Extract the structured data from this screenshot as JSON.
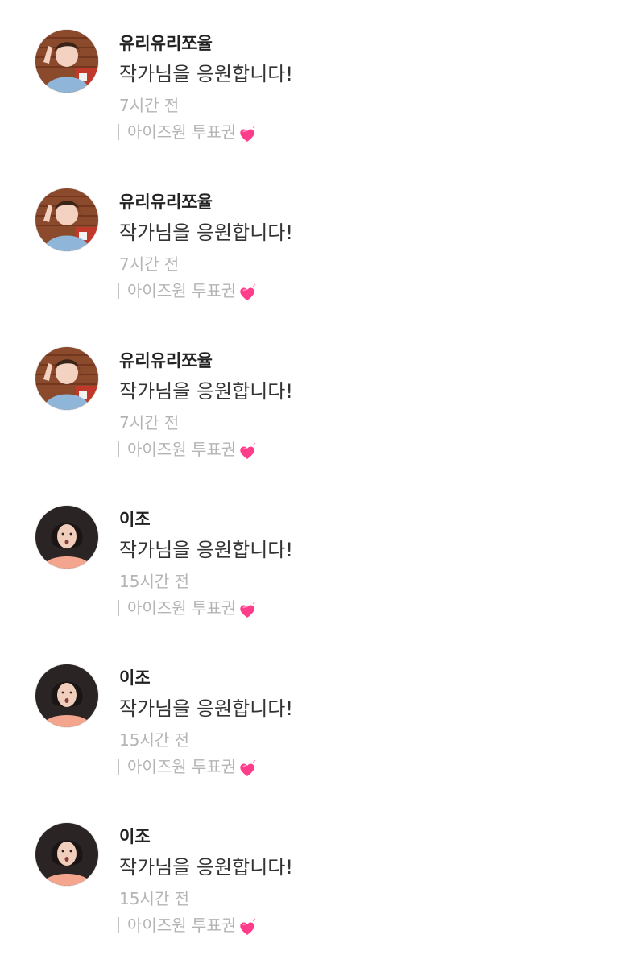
{
  "comments": [
    {
      "username": "유리유리쪼율",
      "text": "작가님을 응원합니다!",
      "time": "7시간 전",
      "vote": "아이즈원 투표권",
      "avatar_icon": "profile-photo-girl-brick-background",
      "heart_icon": "growing-heart-emoji"
    },
    {
      "username": "유리유리쪼율",
      "text": "작가님을 응원합니다!",
      "time": "7시간 전",
      "vote": "아이즈원 투표권",
      "avatar_icon": "profile-photo-girl-brick-background",
      "heart_icon": "growing-heart-emoji"
    },
    {
      "username": "유리유리쪼율",
      "text": "작가님을 응원합니다!",
      "time": "7시간 전",
      "vote": "아이즈원 투표권",
      "avatar_icon": "profile-photo-girl-brick-background",
      "heart_icon": "growing-heart-emoji"
    },
    {
      "username": "이조",
      "text": "작가님을 응원합니다!",
      "time": "15시간 전",
      "vote": "아이즈원 투표권",
      "avatar_icon": "profile-photo-girl-dark-background",
      "heart_icon": "growing-heart-emoji"
    },
    {
      "username": "이조",
      "text": "작가님을 응원합니다!",
      "time": "15시간 전",
      "vote": "아이즈원 투표권",
      "avatar_icon": "profile-photo-girl-dark-background",
      "heart_icon": "growing-heart-emoji"
    },
    {
      "username": "이조",
      "text": "작가님을 응원합니다!",
      "time": "15시간 전",
      "vote": "아이즈원 투표권",
      "avatar_icon": "profile-photo-girl-dark-background",
      "heart_icon": "growing-heart-emoji"
    }
  ],
  "colors": {
    "username": "#222222",
    "comment_text": "#333333",
    "meta_text": "#b4b4b4",
    "heart": "#ff3d8b"
  }
}
